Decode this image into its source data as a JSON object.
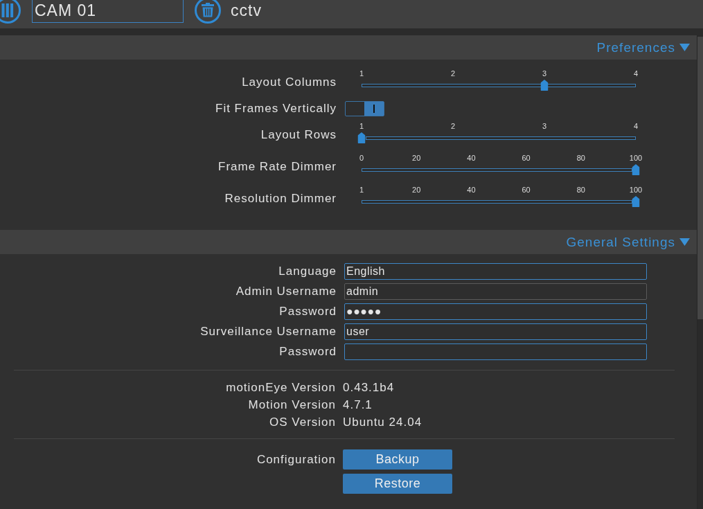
{
  "camera_bar": {
    "camera_name": "CAM 01",
    "host_label": "cctv"
  },
  "preferences": {
    "title": "Preferences",
    "expanded": true,
    "rows": [
      {
        "kind": "slider",
        "label": "Layout Columns",
        "ticks": [
          "1",
          "2",
          "3",
          "4"
        ],
        "level": 0.667
      },
      {
        "kind": "toggle",
        "label": "Fit Frames Vertically",
        "on": true
      },
      {
        "kind": "slider",
        "label": "Layout Rows",
        "ticks": [
          "1",
          "2",
          "3",
          "4"
        ],
        "level": 0
      },
      {
        "kind": "slider",
        "label": "Frame Rate Dimmer",
        "ticks": [
          "0",
          "20",
          "40",
          "60",
          "80",
          "100"
        ],
        "level": 1
      },
      {
        "kind": "slider",
        "label": "Resolution Dimmer",
        "ticks": [
          "1",
          "20",
          "40",
          "60",
          "80",
          "100"
        ],
        "level": 1
      }
    ]
  },
  "general_settings": {
    "title": "General Settings",
    "expanded": true,
    "fields": [
      {
        "label": "Language",
        "value": "English",
        "disabled": false
      },
      {
        "label": "Admin Username",
        "value": "admin",
        "disabled": true
      },
      {
        "label": "Password",
        "value": "●●●●●",
        "disabled": false
      },
      {
        "label": "Surveillance Username",
        "value": "user",
        "disabled": false
      },
      {
        "label": "Password",
        "disabled": false
      }
    ],
    "versions": [
      {
        "label": "motionEye Version",
        "value": "0.43.1b4"
      },
      {
        "label": "Motion Version",
        "value": "4.7.1"
      },
      {
        "label": "OS Version",
        "value": "Ubuntu 24.04"
      }
    ],
    "configuration": {
      "label": "Configuration",
      "buttons": [
        "Backup",
        "Restore"
      ]
    }
  }
}
